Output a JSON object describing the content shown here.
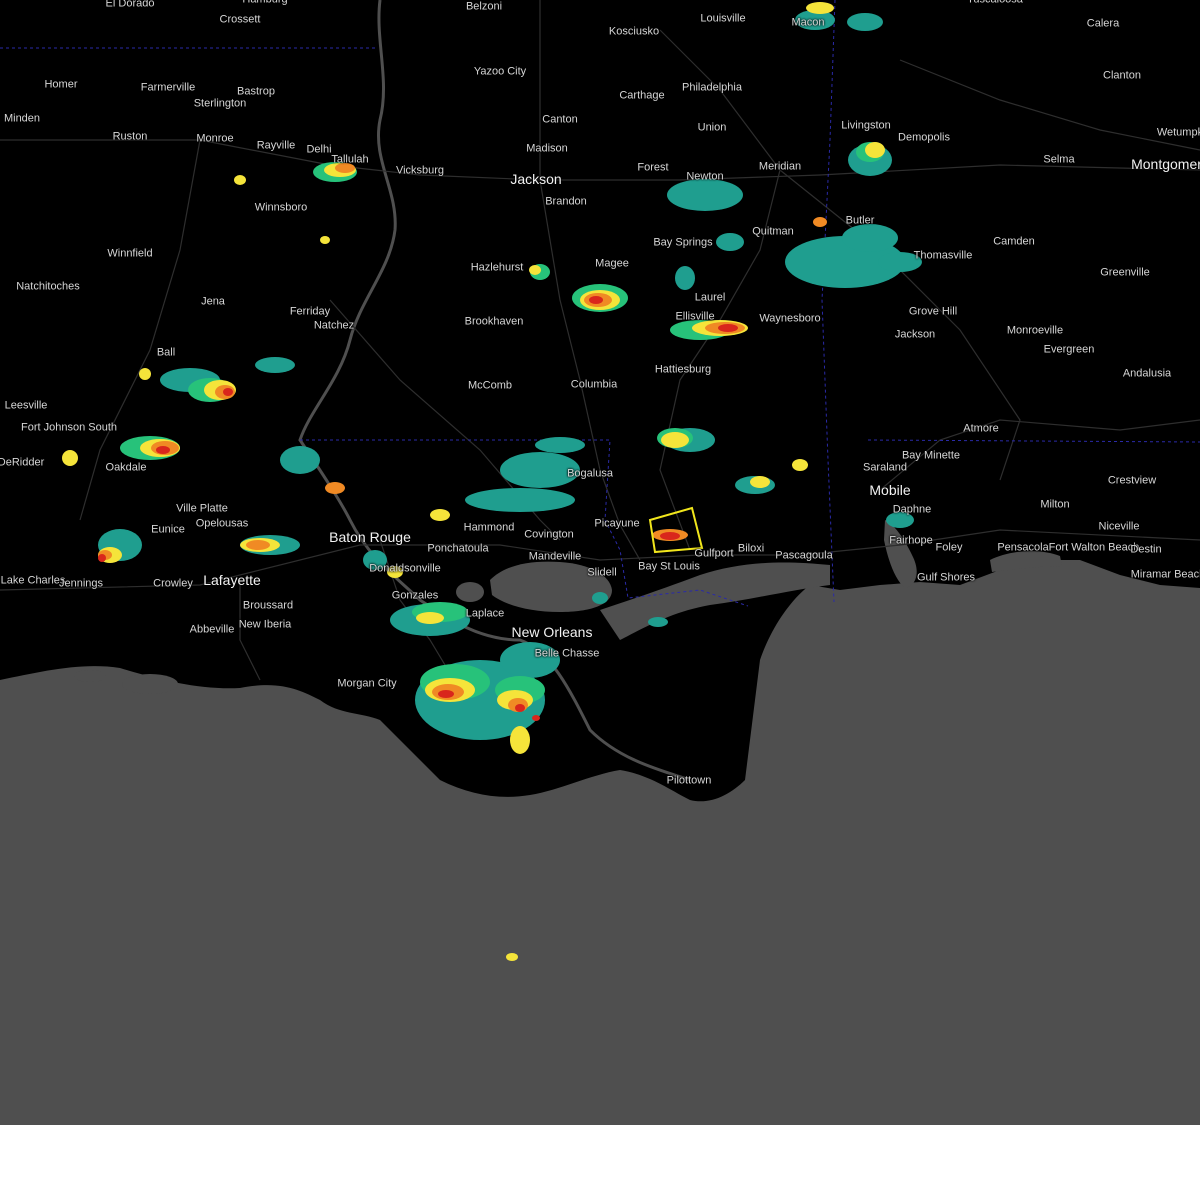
{
  "map": {
    "colors": {
      "land": "#000000",
      "water": "#4f4f4f",
      "roads": "#3a3a3a",
      "state_border": "#2a2aa8",
      "radar_light": "#1f9e8f",
      "radar_moderate": "#27c27a",
      "radar_yellow": "#f5e43a",
      "radar_orange": "#f08a24",
      "radar_red": "#d9261c",
      "warning_polygon": "#f1e61c"
    },
    "cities": [
      {
        "name": "El Dorado",
        "big": false
      },
      {
        "name": "Crossett",
        "big": false
      },
      {
        "name": "Hamburg",
        "big": false
      },
      {
        "name": "Belzoni",
        "big": false
      },
      {
        "name": "Kosciusko",
        "big": false
      },
      {
        "name": "Louisville",
        "big": false
      },
      {
        "name": "Macon",
        "big": false
      },
      {
        "name": "Tuscaloosa",
        "big": false
      },
      {
        "name": "Calera",
        "big": false
      },
      {
        "name": "Clanton",
        "big": false
      },
      {
        "name": "Homer",
        "big": false
      },
      {
        "name": "Farmerville",
        "big": false
      },
      {
        "name": "Bastrop",
        "big": false
      },
      {
        "name": "Sterlington",
        "big": false
      },
      {
        "name": "Yazoo City",
        "big": false
      },
      {
        "name": "Carthage",
        "big": false
      },
      {
        "name": "Philadelphia",
        "big": false
      },
      {
        "name": "Minden",
        "big": false
      },
      {
        "name": "Ruston",
        "big": false
      },
      {
        "name": "Monroe",
        "big": false
      },
      {
        "name": "Rayville",
        "big": false
      },
      {
        "name": "Delhi",
        "big": false
      },
      {
        "name": "Tallulah",
        "big": false
      },
      {
        "name": "Canton",
        "big": false
      },
      {
        "name": "Union",
        "big": false
      },
      {
        "name": "Livingston",
        "big": false
      },
      {
        "name": "Demopolis",
        "big": false
      },
      {
        "name": "Wetumpka",
        "big": false
      },
      {
        "name": "Madison",
        "big": false
      },
      {
        "name": "Selma",
        "big": false
      },
      {
        "name": "Montgomery",
        "big": true
      },
      {
        "name": "Vicksburg",
        "big": false
      },
      {
        "name": "Jackson",
        "big": true
      },
      {
        "name": "Forest",
        "big": false
      },
      {
        "name": "Newton",
        "big": false
      },
      {
        "name": "Meridian",
        "big": false
      },
      {
        "name": "Winnsboro",
        "big": false
      },
      {
        "name": "Brandon",
        "big": false
      },
      {
        "name": "Natchitoches",
        "big": false
      },
      {
        "name": "Winnfield",
        "big": false
      },
      {
        "name": "Hazlehurst",
        "big": false
      },
      {
        "name": "Magee",
        "big": false
      },
      {
        "name": "Bay Springs",
        "big": false
      },
      {
        "name": "Quitman",
        "big": false
      },
      {
        "name": "Butler",
        "big": false
      },
      {
        "name": "Camden",
        "big": false
      },
      {
        "name": "Thomasville",
        "big": false
      },
      {
        "name": "Greenville",
        "big": false
      },
      {
        "name": "Jena",
        "big": false
      },
      {
        "name": "Ferriday",
        "big": false
      },
      {
        "name": "Natchez",
        "big": false
      },
      {
        "name": "Brookhaven",
        "big": false
      },
      {
        "name": "Laurel",
        "big": false
      },
      {
        "name": "Ellisville",
        "big": false
      },
      {
        "name": "Waynesboro",
        "big": false
      },
      {
        "name": "Grove Hill",
        "big": false
      },
      {
        "name": "Jackson",
        "big": false
      },
      {
        "name": "Monroeville",
        "big": false
      },
      {
        "name": "Evergreen",
        "big": false
      },
      {
        "name": "Ball",
        "big": false
      },
      {
        "name": "McComb",
        "big": false
      },
      {
        "name": "Columbia",
        "big": false
      },
      {
        "name": "Hattiesburg",
        "big": false
      },
      {
        "name": "Andalusia",
        "big": false
      },
      {
        "name": "Leesville",
        "big": false
      },
      {
        "name": "Fort Johnson South",
        "big": false
      },
      {
        "name": "Atmore",
        "big": false
      },
      {
        "name": "DeRidder",
        "big": false
      },
      {
        "name": "Oakdale",
        "big": false
      },
      {
        "name": "Bogalusa",
        "big": false
      },
      {
        "name": "Saraland",
        "big": false
      },
      {
        "name": "Bay Minette",
        "big": false
      },
      {
        "name": "Crestview",
        "big": false
      },
      {
        "name": "Mobile",
        "big": true
      },
      {
        "name": "Ville Platte",
        "big": false
      },
      {
        "name": "Eunice",
        "big": false
      },
      {
        "name": "Opelousas",
        "big": false
      },
      {
        "name": "Baton Rouge",
        "big": true
      },
      {
        "name": "Hammond",
        "big": false
      },
      {
        "name": "Covington",
        "big": false
      },
      {
        "name": "Picayune",
        "big": false
      },
      {
        "name": "Daphne",
        "big": false
      },
      {
        "name": "Milton",
        "big": false
      },
      {
        "name": "Niceville",
        "big": false
      },
      {
        "name": "Ponchatoula",
        "big": false
      },
      {
        "name": "Gulfport",
        "big": false
      },
      {
        "name": "Biloxi",
        "big": false
      },
      {
        "name": "Pascagoula",
        "big": false
      },
      {
        "name": "Fairhope",
        "big": false
      },
      {
        "name": "Foley",
        "big": false
      },
      {
        "name": "Pensacola",
        "big": false
      },
      {
        "name": "Fort Walton Beach",
        "big": false
      },
      {
        "name": "Destin",
        "big": false
      },
      {
        "name": "Mandeville",
        "big": false
      },
      {
        "name": "Donaldsonville",
        "big": false
      },
      {
        "name": "Bay St Louis",
        "big": false
      },
      {
        "name": "Slidell",
        "big": false
      },
      {
        "name": "Miramar Beach",
        "big": false
      },
      {
        "name": "Lake Charles",
        "big": false
      },
      {
        "name": "Jennings",
        "big": false
      },
      {
        "name": "Crowley",
        "big": false
      },
      {
        "name": "Lafayette",
        "big": true
      },
      {
        "name": "Gulf Shores",
        "big": false
      },
      {
        "name": "Gonzales",
        "big": false
      },
      {
        "name": "Broussard",
        "big": false
      },
      {
        "name": "Laplace",
        "big": false
      },
      {
        "name": "New Iberia",
        "big": false
      },
      {
        "name": "Abbeville",
        "big": false
      },
      {
        "name": "New Orleans",
        "big": true
      },
      {
        "name": "Belle Chasse",
        "big": false
      },
      {
        "name": "Morgan City",
        "big": false
      },
      {
        "name": "Pilottown",
        "big": false
      }
    ]
  }
}
